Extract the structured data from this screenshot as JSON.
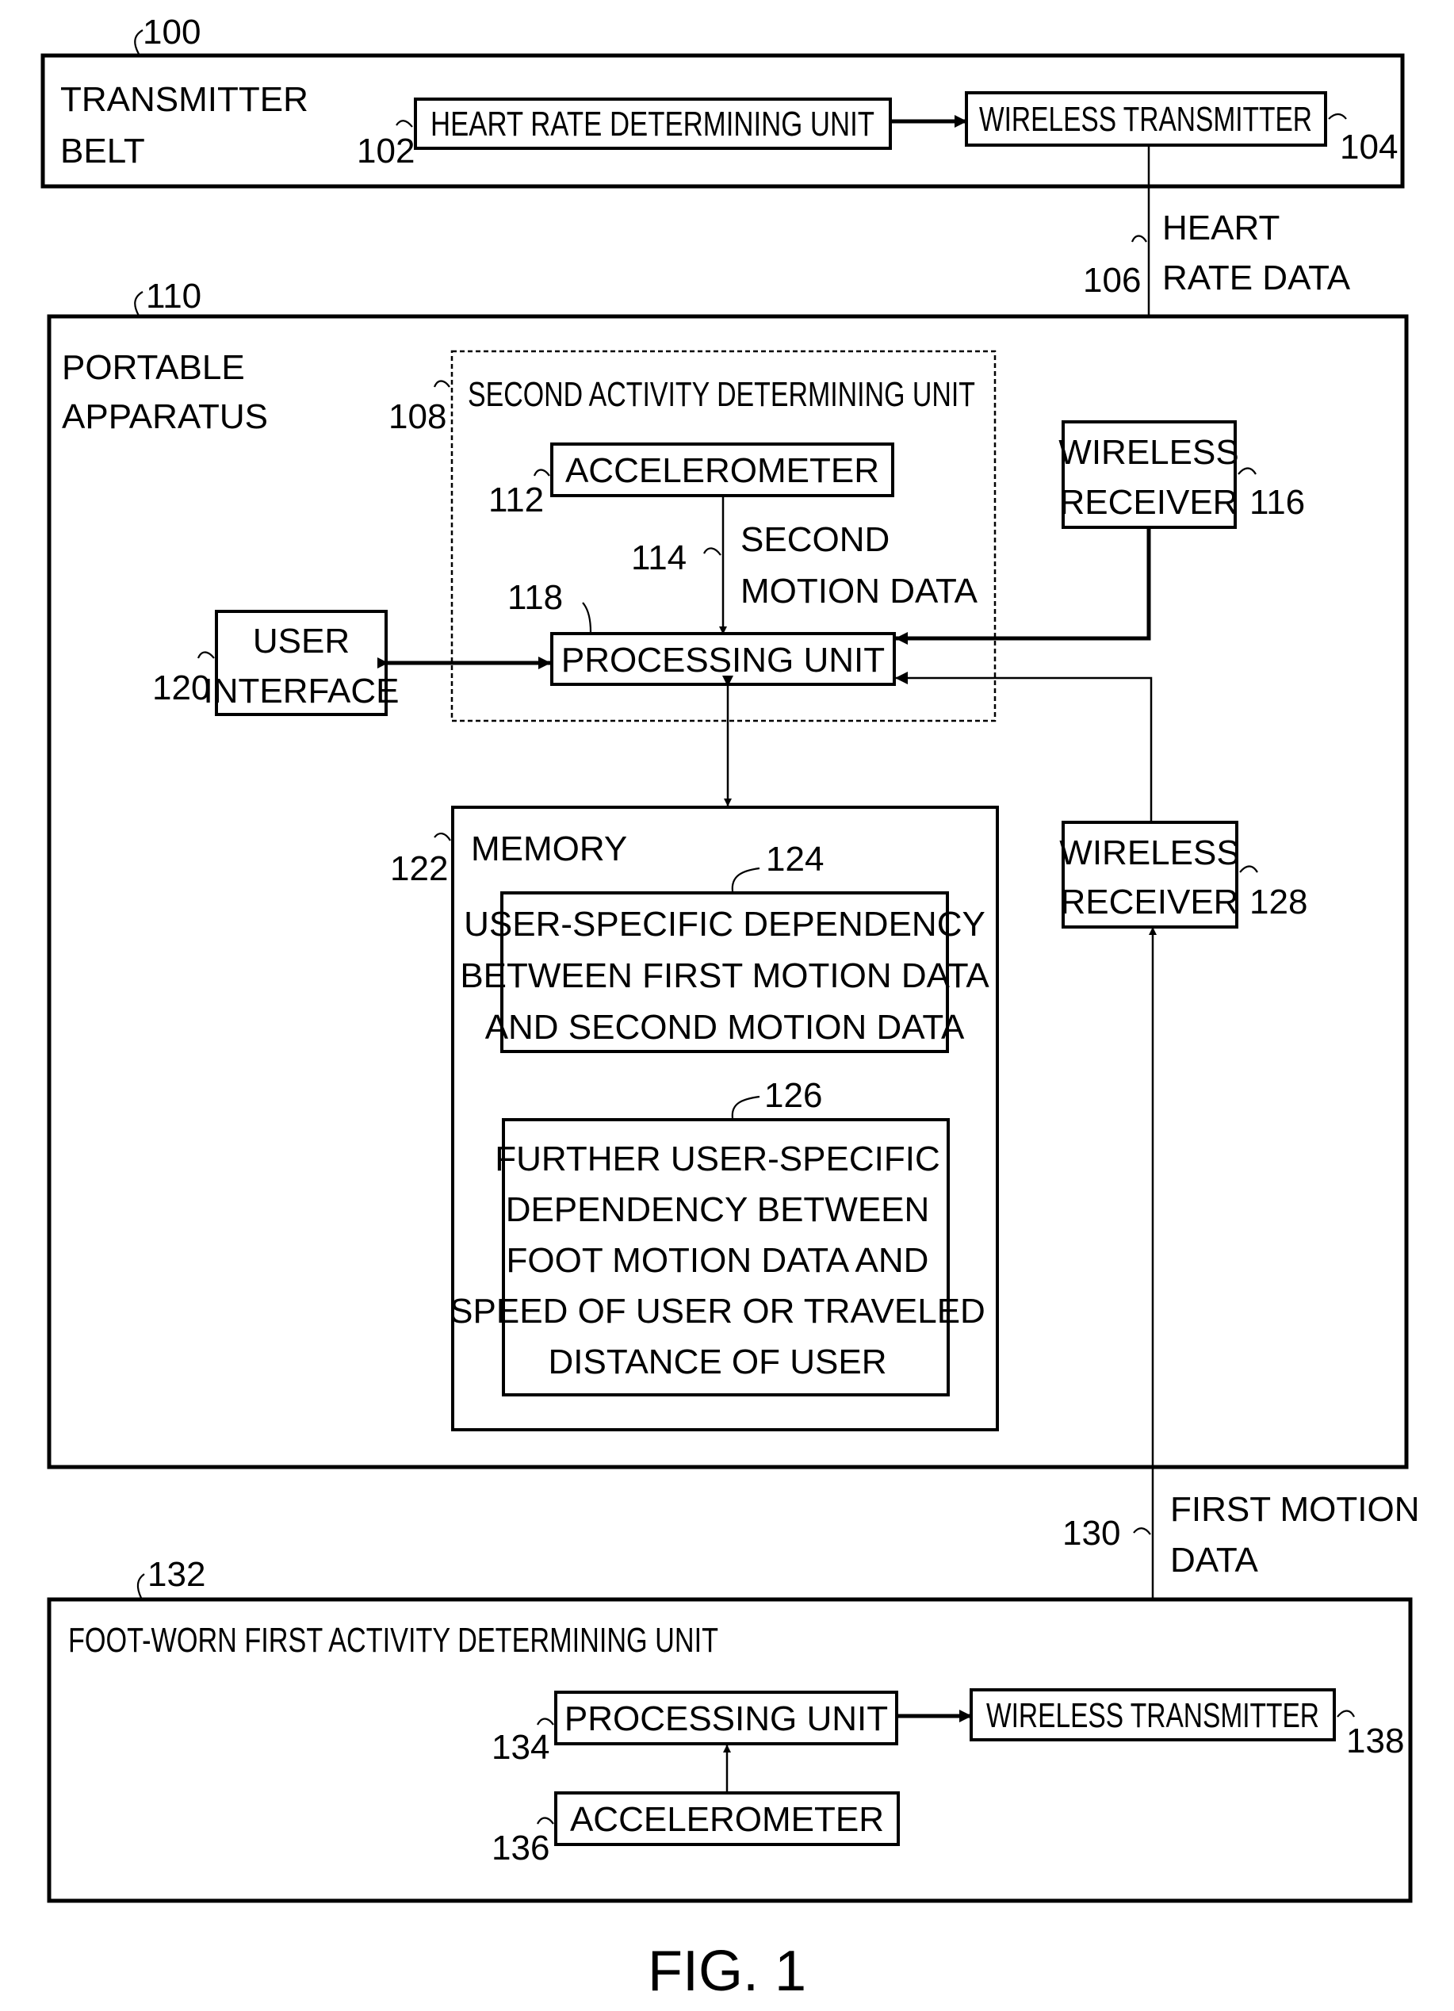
{
  "figure": {
    "caption": "FIG. 1",
    "blocks": {
      "transmitter_belt": {
        "ref": "100",
        "label_lines": [
          "TRANSMITTER",
          "BELT"
        ]
      },
      "heart_rate_unit": {
        "ref": "102",
        "label": "HEART RATE  DETERMINING UNIT"
      },
      "wireless_transmitter_belt": {
        "ref": "104",
        "label": "WIRELESS TRANSMITTER"
      },
      "heart_rate_data": {
        "ref": "106",
        "label_lines": [
          "HEART",
          "RATE DATA"
        ]
      },
      "portable_apparatus": {
        "ref": "110",
        "label_lines": [
          "PORTABLE",
          "APPARATUS"
        ]
      },
      "second_activity_unit": {
        "ref": "108",
        "label": "SECOND ACTIVITY DETERMINING UNIT"
      },
      "accelerometer_2": {
        "ref": "112",
        "label": "ACCELEROMETER"
      },
      "second_motion_data": {
        "ref": "114",
        "label_lines": [
          "SECOND",
          "MOTION DATA"
        ]
      },
      "processing_unit_2": {
        "ref": "118",
        "label": "PROCESSING UNIT"
      },
      "user_interface": {
        "ref": "120",
        "label_lines": [
          "USER",
          "INTERFACE"
        ]
      },
      "wireless_receiver_hr": {
        "ref": "116",
        "label_lines": [
          "WIRELESS",
          "RECEIVER"
        ]
      },
      "memory": {
        "ref": "122",
        "label": "MEMORY"
      },
      "dependency_1": {
        "ref": "124",
        "label_lines": [
          "USER-SPECIFIC DEPENDENCY",
          "BETWEEN FIRST MOTION DATA",
          "AND SECOND MOTION DATA"
        ]
      },
      "dependency_2": {
        "ref": "126",
        "label_lines": [
          "FURTHER USER-SPECIFIC",
          "DEPENDENCY BETWEEN",
          "FOOT MOTION DATA AND",
          "SPEED OF USER OR TRAVELED",
          "DISTANCE OF USER"
        ]
      },
      "wireless_receiver_foot": {
        "ref": "128",
        "label_lines": [
          "WIRELESS",
          "RECEIVER"
        ]
      },
      "first_motion_data": {
        "ref": "130",
        "label_lines": [
          "FIRST MOTION",
          "DATA"
        ]
      },
      "foot_worn_unit": {
        "ref": "132",
        "label": "FOOT-WORN FIRST ACTIVITY DETERMINING UNIT"
      },
      "processing_unit_1": {
        "ref": "134",
        "label": "PROCESSING UNIT"
      },
      "accelerometer_1": {
        "ref": "136",
        "label": "ACCELEROMETER"
      },
      "wireless_transmitter_foot": {
        "ref": "138",
        "label": "WIRELESS TRANSMITTER"
      }
    }
  }
}
